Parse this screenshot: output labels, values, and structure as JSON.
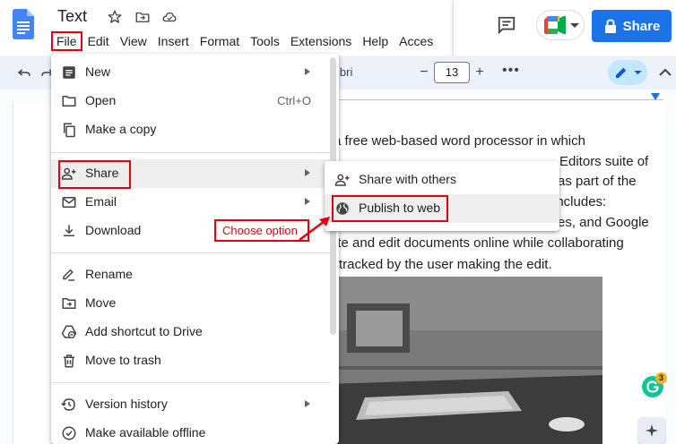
{
  "doc": {
    "title": "Text",
    "lines": [
      "a free web-based word processor in which",
      "Editors suite of",
      "as part of the",
      "includes:",
      "es, and Google",
      "ate and edit documents online while collaborating",
      "tracked by the user making the edit."
    ]
  },
  "menubar": {
    "items": [
      "File",
      "Edit",
      "View",
      "Insert",
      "Format",
      "Tools",
      "Extensions",
      "Help",
      "Acces"
    ]
  },
  "header": {
    "share_label": "Share"
  },
  "toolbar": {
    "font_name": "ibri",
    "font_size": "13",
    "decrease_label": "−",
    "increase_label": "+",
    "more_label": "•••"
  },
  "file_menu": {
    "items": [
      {
        "label": "New",
        "icon": "new-document-icon",
        "submenu": true
      },
      {
        "label": "Open",
        "icon": "folder-icon",
        "shortcut": "Ctrl+O"
      },
      {
        "label": "Make a copy",
        "icon": "copy-icon"
      },
      {
        "label": "Share",
        "icon": "person-add-icon",
        "submenu": true
      },
      {
        "label": "Email",
        "icon": "mail-icon",
        "submenu": true
      },
      {
        "label": "Download",
        "icon": "download-icon",
        "submenu": true
      },
      {
        "label": "Rename",
        "icon": "rename-icon"
      },
      {
        "label": "Move",
        "icon": "move-folder-icon"
      },
      {
        "label": "Add shortcut to Drive",
        "icon": "drive-shortcut-icon"
      },
      {
        "label": "Move to trash",
        "icon": "trash-icon"
      },
      {
        "label": "Version history",
        "icon": "history-icon",
        "submenu": true
      },
      {
        "label": "Make available offline",
        "icon": "offline-icon"
      }
    ]
  },
  "share_submenu": {
    "items": [
      {
        "label": "Share with others",
        "icon": "person-add-icon"
      },
      {
        "label": "Publish to web",
        "icon": "globe-icon"
      }
    ]
  },
  "annotation": {
    "label": "Choose option"
  },
  "grammarly": {
    "count": "3"
  },
  "colors": {
    "accent": "#1a73e8",
    "highlight": "#e2000f"
  }
}
